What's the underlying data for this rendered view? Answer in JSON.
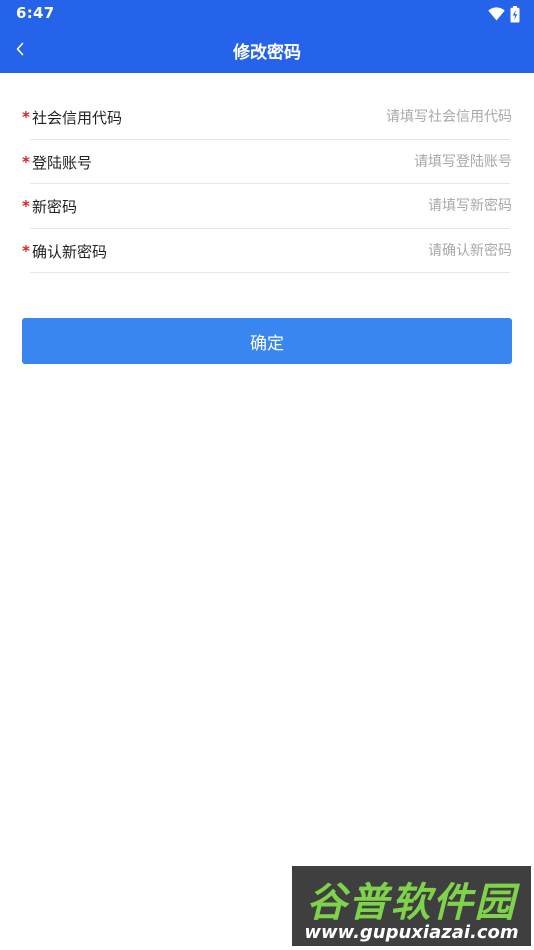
{
  "status_bar": {
    "time": "6:47",
    "icons": [
      "wifi-icon",
      "battery-charging-icon"
    ]
  },
  "nav": {
    "title": "修改密码",
    "back_icon": "chevron-left-icon"
  },
  "form": {
    "fields": [
      {
        "required_mark": "*",
        "label": "社会信用代码",
        "placeholder": "请填写社会信用代码",
        "value": ""
      },
      {
        "required_mark": "*",
        "label": "登陆账号",
        "placeholder": "请填写登陆账号",
        "value": ""
      },
      {
        "required_mark": "*",
        "label": "新密码",
        "placeholder": "请填写新密码",
        "value": ""
      },
      {
        "required_mark": "*",
        "label": "确认新密码",
        "placeholder": "请确认新密码",
        "value": ""
      }
    ],
    "submit_label": "确定"
  },
  "watermark": {
    "name": "谷普软件园",
    "url": "www.gupuxiazai.com"
  },
  "colors": {
    "header": "#2563eb",
    "button": "#3a86f0",
    "required": "#e02020",
    "placeholder": "#a8a8a8"
  }
}
